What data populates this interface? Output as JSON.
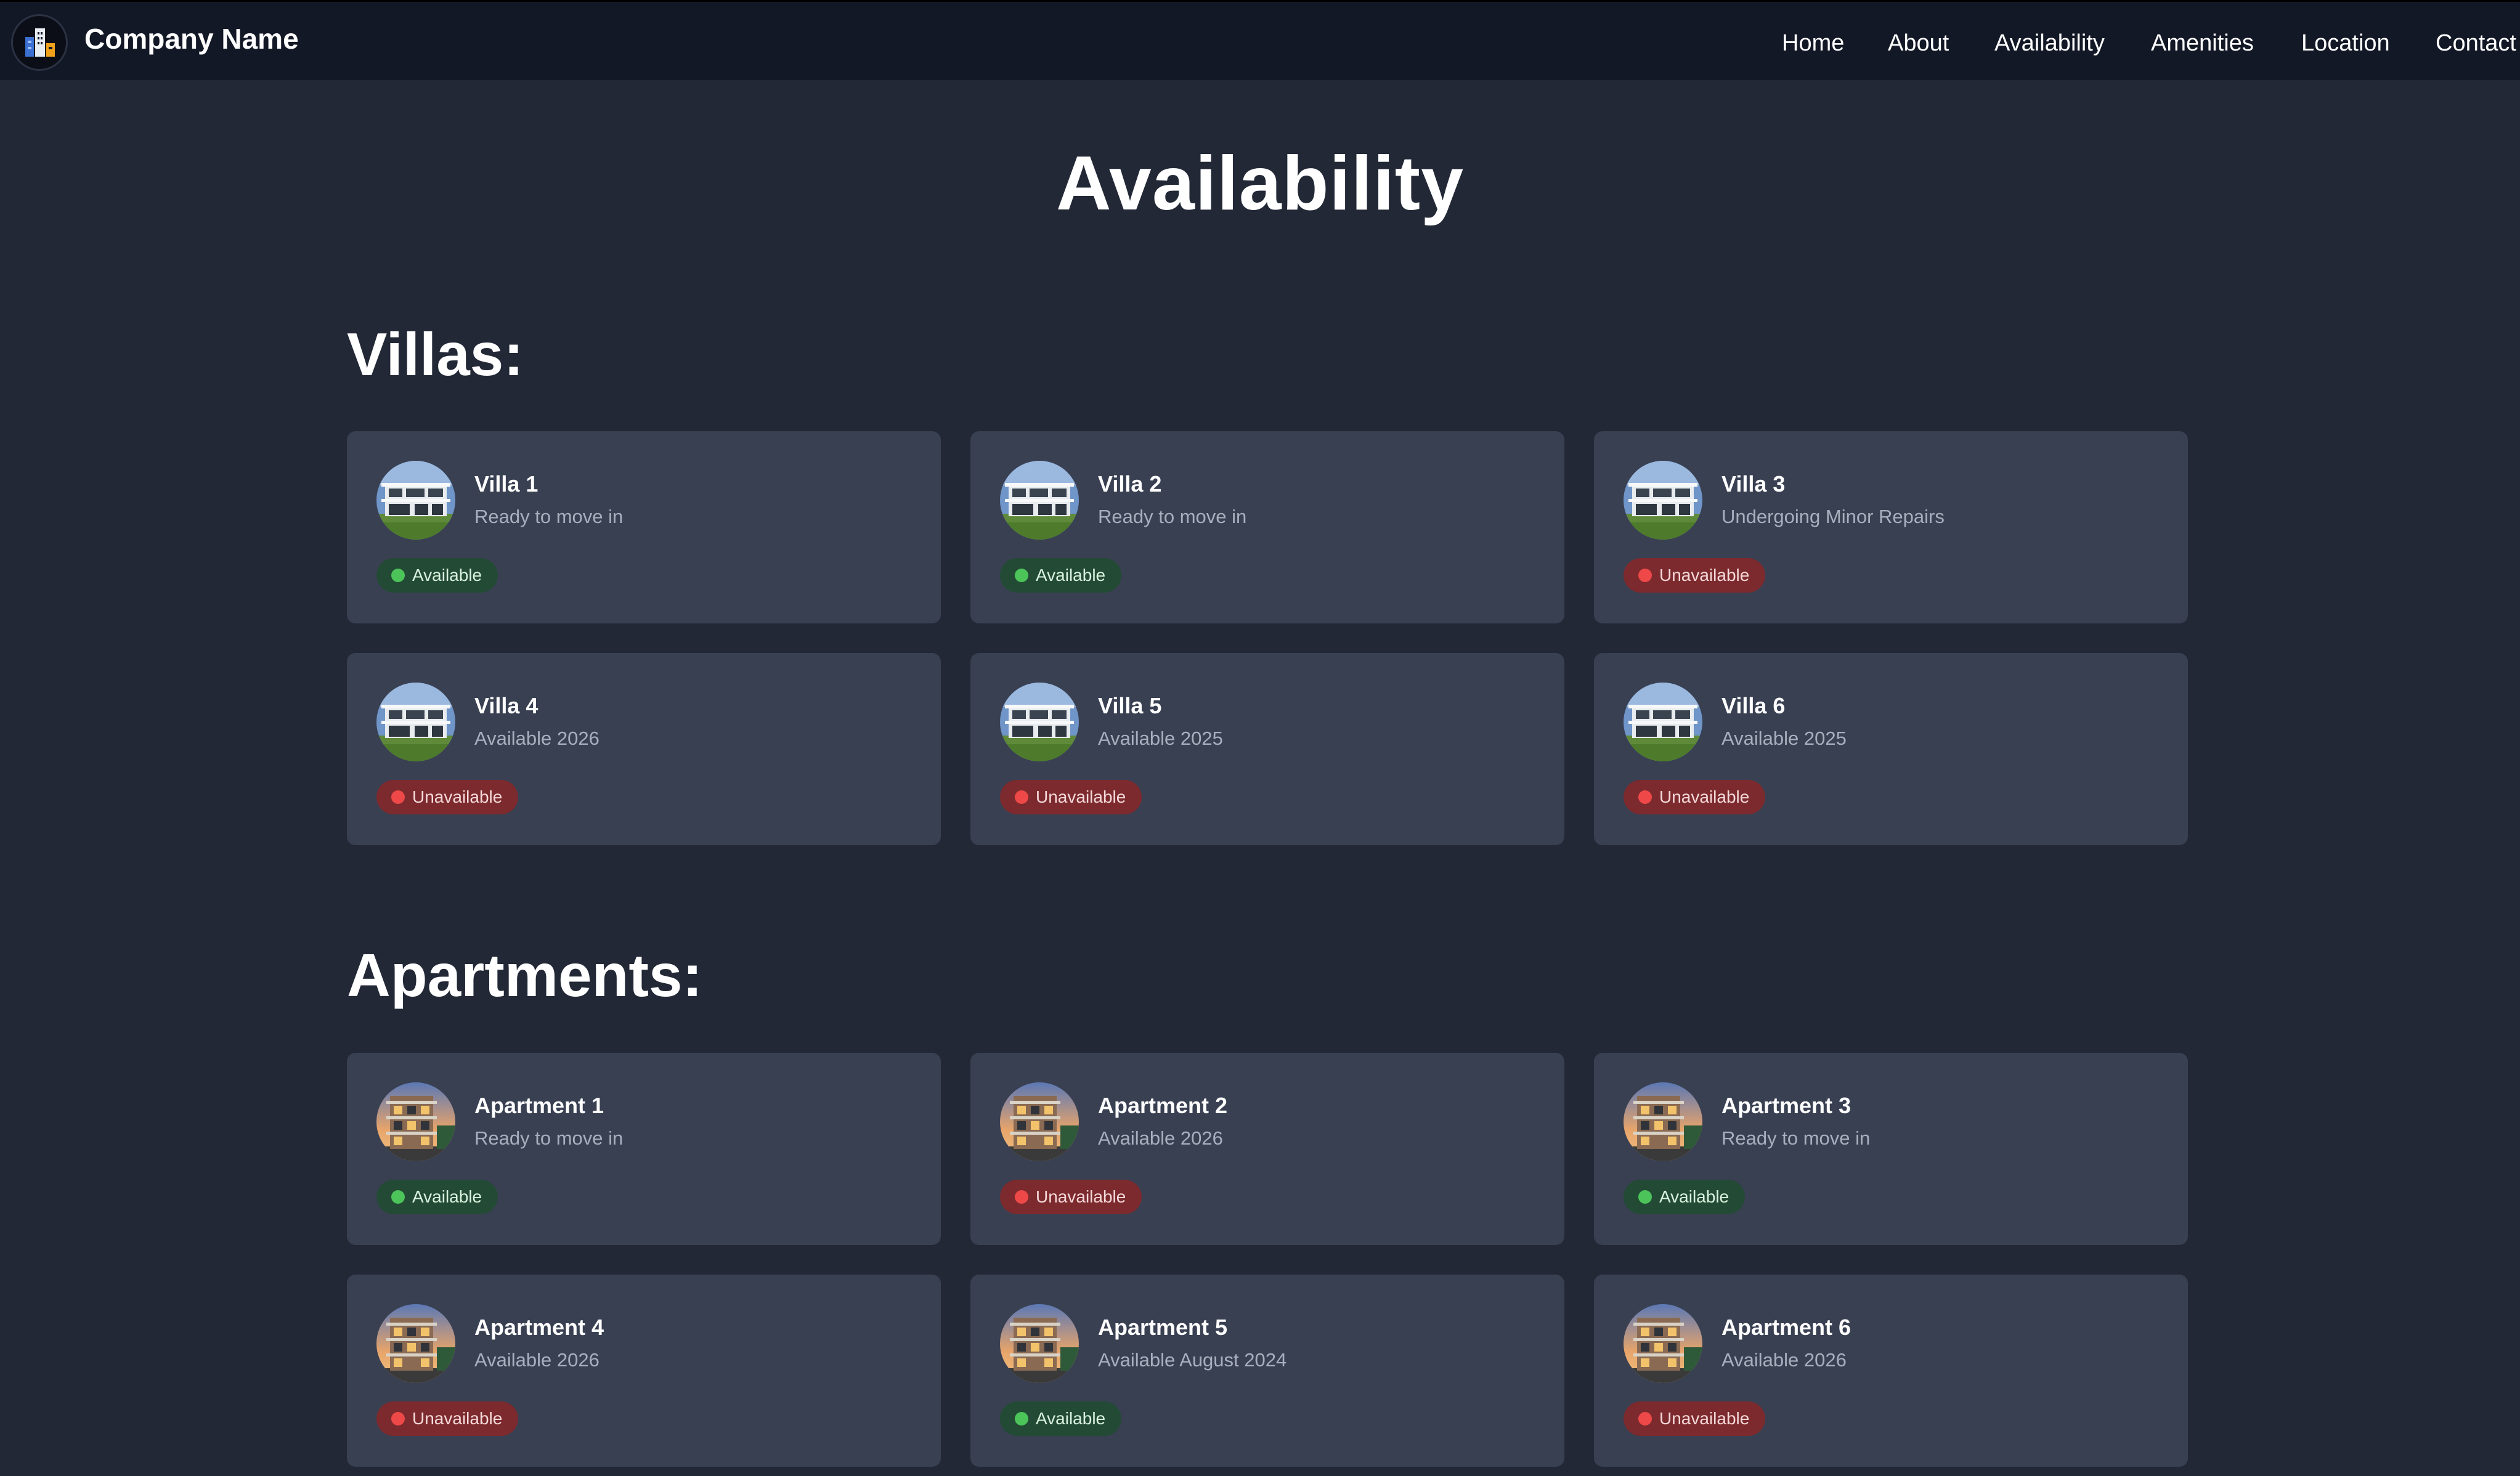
{
  "brand": {
    "name": "Company Name",
    "logo_icon": "building-logo-icon"
  },
  "nav": {
    "links": [
      "Home",
      "About",
      "Availability",
      "Amenities",
      "Location",
      "Contact"
    ]
  },
  "page": {
    "title": "Availability"
  },
  "colors": {
    "background": "#222836",
    "navbar": "#131826",
    "card": "#394052",
    "available_badge": "#234a35",
    "available_dot": "#4cc45a",
    "unavailable_badge": "#7c2a2e",
    "unavailable_dot": "#ee4848"
  },
  "sections": [
    {
      "title": "Villas:",
      "thumb_icon": "villa-photo-icon",
      "items": [
        {
          "name": "Villa 1",
          "desc": "Ready to move in",
          "status": "Available"
        },
        {
          "name": "Villa 2",
          "desc": "Ready to move in",
          "status": "Available"
        },
        {
          "name": "Villa 3",
          "desc": "Undergoing Minor Repairs",
          "status": "Unavailable"
        },
        {
          "name": "Villa 4",
          "desc": "Available 2026",
          "status": "Unavailable"
        },
        {
          "name": "Villa 5",
          "desc": "Available 2025",
          "status": "Unavailable"
        },
        {
          "name": "Villa 6",
          "desc": "Available 2025",
          "status": "Unavailable"
        }
      ]
    },
    {
      "title": "Apartments:",
      "thumb_icon": "apartment-photo-icon",
      "items": [
        {
          "name": "Apartment 1",
          "desc": "Ready to move in",
          "status": "Available"
        },
        {
          "name": "Apartment 2",
          "desc": "Available 2026",
          "status": "Unavailable"
        },
        {
          "name": "Apartment 3",
          "desc": "Ready to move in",
          "status": "Available"
        },
        {
          "name": "Apartment 4",
          "desc": "Available 2026",
          "status": "Unavailable"
        },
        {
          "name": "Apartment 5",
          "desc": "Available August 2024",
          "status": "Available"
        },
        {
          "name": "Apartment 6",
          "desc": "Available 2026",
          "status": "Unavailable"
        }
      ]
    }
  ]
}
